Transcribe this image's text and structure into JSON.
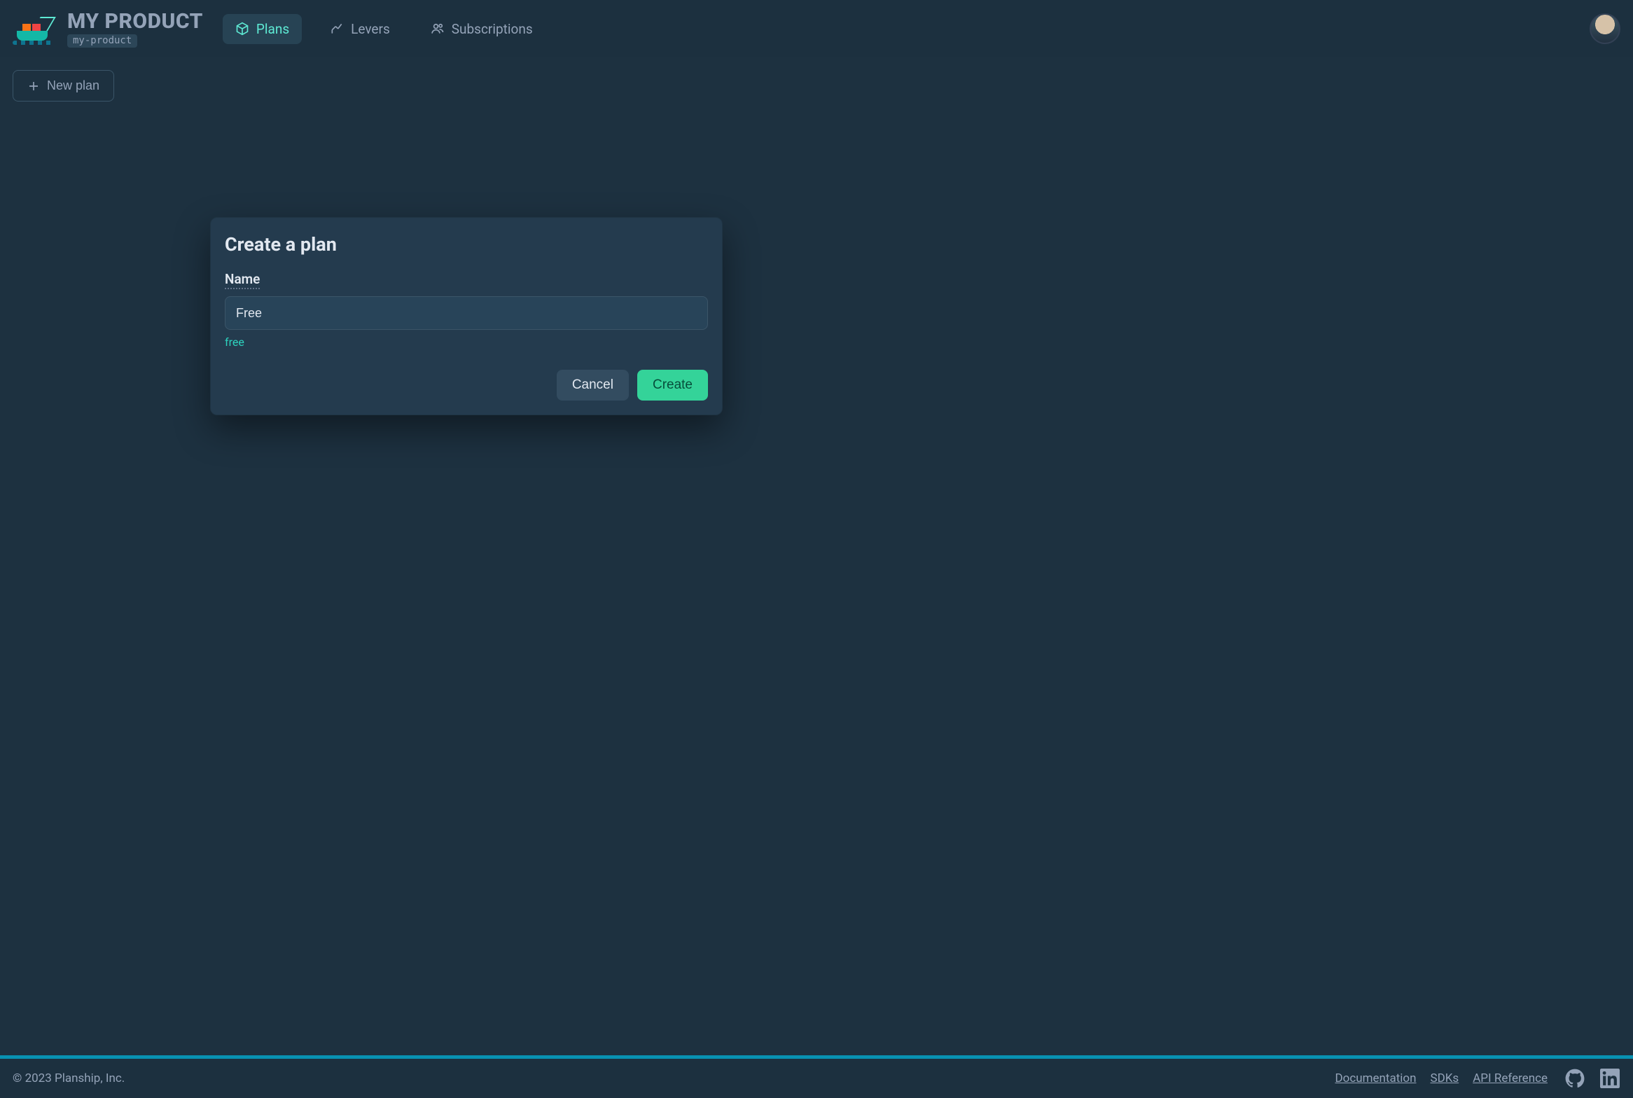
{
  "header": {
    "product_title": "MY PRODUCT",
    "product_slug": "my-product",
    "tabs": [
      {
        "label": "Plans",
        "icon": "package-icon",
        "active": true
      },
      {
        "label": "Levers",
        "icon": "levers-icon",
        "active": false
      },
      {
        "label": "Subscriptions",
        "icon": "users-icon",
        "active": false
      }
    ]
  },
  "toolbar": {
    "new_plan_label": "New plan"
  },
  "modal": {
    "title": "Create a plan",
    "name_label": "Name",
    "name_value": "Free",
    "slug_preview": "free",
    "cancel_label": "Cancel",
    "create_label": "Create"
  },
  "footer": {
    "copyright": "© 2023 Planship, Inc.",
    "links": [
      {
        "label": "Documentation"
      },
      {
        "label": "SDKs"
      },
      {
        "label": "API Reference"
      }
    ],
    "social": {
      "github": "github-icon",
      "linkedin": "linkedin-icon"
    }
  }
}
